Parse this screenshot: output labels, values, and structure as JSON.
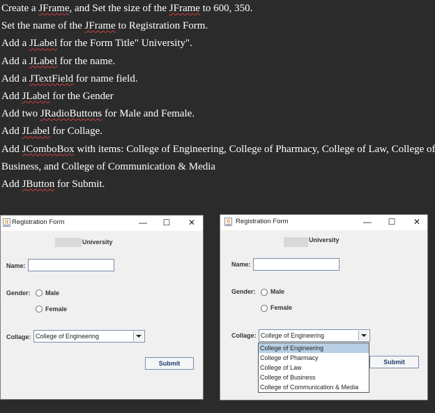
{
  "instructions": [
    {
      "segments": [
        {
          "t": "Create a "
        },
        {
          "t": "JFrame",
          "sq": true
        },
        {
          "t": ", and Set the size of the "
        },
        {
          "t": "JFrame",
          "sq": true
        },
        {
          "t": " to 600, 350."
        }
      ]
    },
    {
      "segments": [
        {
          "t": "Set the name of the "
        },
        {
          "t": "JFrame",
          "sq": true
        },
        {
          "t": " to Registration Form."
        }
      ]
    },
    {
      "segments": [
        {
          "t": "Add a "
        },
        {
          "t": "JLabel",
          "sq": true
        },
        {
          "t": " for the Form Title\" University\"."
        }
      ]
    },
    {
      "segments": [
        {
          "t": "Add a "
        },
        {
          "t": "JLabel",
          "sq": true
        },
        {
          "t": " for the name."
        }
      ]
    },
    {
      "segments": [
        {
          "t": "Add a "
        },
        {
          "t": "JTextField",
          "sq": true
        },
        {
          "t": " for name field."
        }
      ]
    },
    {
      "segments": [
        {
          "t": "Add "
        },
        {
          "t": "JLabel",
          "sq": true
        },
        {
          "t": " for the Gender"
        }
      ]
    },
    {
      "segments": [
        {
          "t": "Add two "
        },
        {
          "t": "JRadioButtons",
          "sq": true
        },
        {
          "t": " for Male and Female."
        }
      ]
    },
    {
      "segments": [
        {
          "t": "Add "
        },
        {
          "t": "JLabel",
          "sq": true
        },
        {
          "t": " for Collage."
        }
      ]
    },
    {
      "segments": [
        {
          "t": "Add "
        },
        {
          "t": "JComboBox",
          "sq": true
        },
        {
          "t": " with items: College of Engineering, College of Pharmacy, College of Law, College of"
        }
      ]
    },
    {
      "segments": [
        {
          "t": "Business, and College of Communication & Media"
        }
      ]
    },
    {
      "segments": [
        {
          "t": "Add "
        },
        {
          "t": "JButton",
          "sq": true
        },
        {
          "t": " for Submit."
        }
      ]
    }
  ],
  "form": {
    "window_title": "Registration Form",
    "controls": {
      "minimize": "—",
      "maximize": "☐",
      "close": "✕"
    },
    "heading": "University",
    "name_label": "Name:",
    "name_value": "",
    "gender_label": "Gender:",
    "male_label": "Male",
    "female_label": "Female",
    "college_label": "Collage:",
    "college_selected": "College of Engineering",
    "college_options": [
      "College of Engineering",
      "College of Pharmacy",
      "College of Law",
      "College of Business",
      "College of Communication & Media"
    ],
    "submit_label": "Submit"
  },
  "colors": {
    "page_bg": "#2b2b2b",
    "window_bg": "#f0f0f0",
    "selection": "#b8cfe5",
    "java_icon": "#e76f00"
  },
  "icons": [
    "java-icon",
    "minimize-icon",
    "maximize-icon",
    "close-icon",
    "dropdown-arrow-icon"
  ]
}
